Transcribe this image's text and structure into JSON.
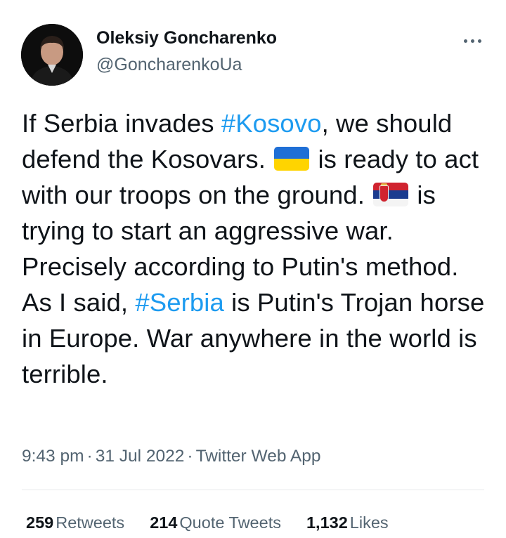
{
  "author": {
    "display_name": "Oleksiy Goncharenko",
    "handle": "@GoncharenkoUa",
    "avatar_icon": "profile-photo"
  },
  "more_icon": "more-horizontal-icon",
  "tweet": {
    "segments": [
      "If Serbia invades ",
      "#Kosovo",
      ", we should defend the Kosovars. ",
      " is ready to act with our troops on the ground. ",
      " is trying to start an aggressive war. Precisely according to Putin's method. As I said, ",
      "#Serbia",
      " is Putin's Trojan horse in Europe. War anywhere in the world is terrible."
    ],
    "flag_ukraine": "ukraine-flag-icon",
    "flag_serbia": "serbia-flag-icon"
  },
  "meta": {
    "time": "9:43 pm",
    "separator": "·",
    "date": "31 Jul 2022",
    "source": "Twitter Web App"
  },
  "stats": {
    "retweets_count": "259",
    "retweets_label": "Retweets",
    "quotes_count": "214",
    "quotes_label": "Quote Tweets",
    "likes_count": "1,132",
    "likes_label": "Likes"
  },
  "colors": {
    "hashtag": "#1d9bf0",
    "secondary_text": "#536471",
    "primary_text": "#0f1419"
  }
}
